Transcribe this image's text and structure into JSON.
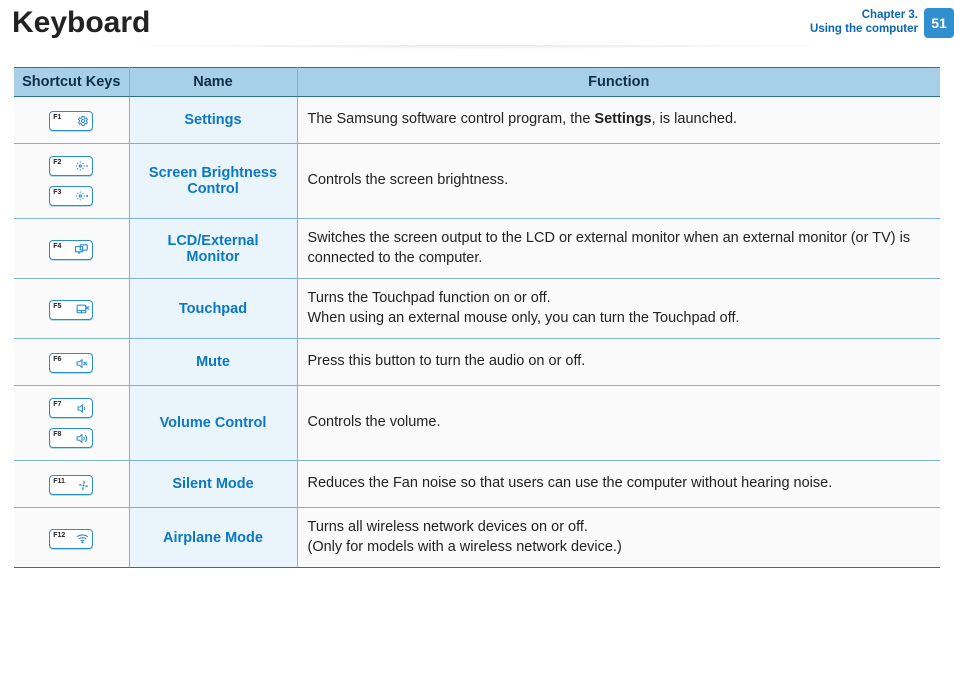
{
  "header": {
    "title": "Keyboard",
    "chapter_line1": "Chapter 3.",
    "chapter_line2": "Using the computer",
    "page_number": "51"
  },
  "table": {
    "headers": {
      "c1": "Shortcut Keys",
      "c2": "Name",
      "c3": "Function"
    },
    "rows": [
      {
        "keys": [
          "F1"
        ],
        "icons": [
          "settings"
        ],
        "name": "Settings",
        "func_pre": "The Samsung software control program, the ",
        "func_bold": "Settings",
        "func_post": ", is launched."
      },
      {
        "keys": [
          "F2",
          "F3"
        ],
        "icons": [
          "bright-down",
          "bright-up"
        ],
        "name": "Screen Brightness Control",
        "func": "Controls the screen brightness."
      },
      {
        "keys": [
          "F4"
        ],
        "icons": [
          "monitor-switch"
        ],
        "name": "LCD/External Monitor",
        "func": "Switches the screen output to the LCD or external monitor when an external monitor (or TV) is connected to the computer."
      },
      {
        "keys": [
          "F5"
        ],
        "icons": [
          "touchpad-off"
        ],
        "name": "Touchpad",
        "func_line1": "Turns the Touchpad function on or off.",
        "func_line2": "When using an external mouse only, you can turn the Touchpad off."
      },
      {
        "keys": [
          "F6"
        ],
        "icons": [
          "mute"
        ],
        "name": "Mute",
        "func": "Press this button to turn the audio on or off."
      },
      {
        "keys": [
          "F7",
          "F8"
        ],
        "icons": [
          "vol-down",
          "vol-up"
        ],
        "name": "Volume Control",
        "func": "Controls the volume."
      },
      {
        "keys": [
          "F11"
        ],
        "icons": [
          "fan"
        ],
        "name": "Silent Mode",
        "func": "Reduces the Fan noise so that users can use the computer without hearing noise."
      },
      {
        "keys": [
          "F12"
        ],
        "icons": [
          "wifi"
        ],
        "name": "Airplane Mode",
        "func_line1": "Turns all wireless network devices on or off.",
        "func_line2": "(Only for models with a wireless network device.)"
      }
    ]
  }
}
